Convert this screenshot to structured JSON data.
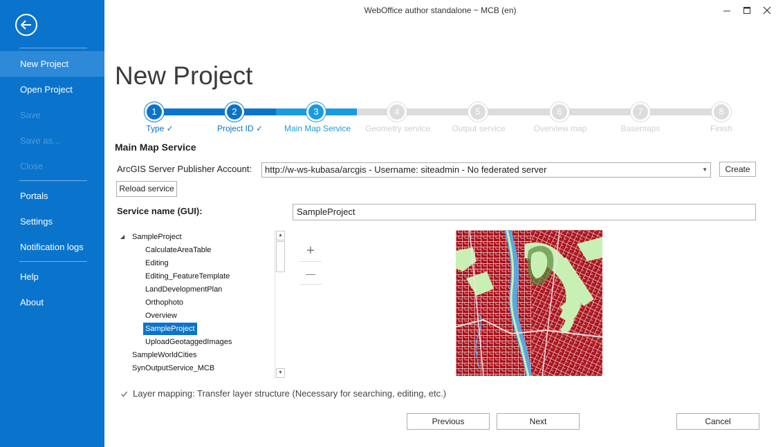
{
  "window": {
    "title": "WebOffice author standalone ~ MCB (en)"
  },
  "sidebar": {
    "items": [
      {
        "label": "New Project",
        "state": "active"
      },
      {
        "label": "Open Project",
        "state": "normal"
      },
      {
        "label": "Save",
        "state": "disabled"
      },
      {
        "label": "Save as...",
        "state": "disabled"
      },
      {
        "label": "Close",
        "state": "disabled"
      },
      {
        "label": "Portals",
        "state": "normal"
      },
      {
        "label": "Settings",
        "state": "normal"
      },
      {
        "label": "Notification logs",
        "state": "normal"
      },
      {
        "label": "Help",
        "state": "normal"
      },
      {
        "label": "About",
        "state": "normal"
      }
    ]
  },
  "page": {
    "title": "New Project"
  },
  "wizard": {
    "steps": [
      {
        "number": "1",
        "label": "Type ✓",
        "status": "done"
      },
      {
        "number": "2",
        "label": "Project ID ✓",
        "status": "done"
      },
      {
        "number": "3",
        "label": "Main Map Service",
        "status": "current"
      },
      {
        "number": "4",
        "label": "Geometry service",
        "status": "pending"
      },
      {
        "number": "5",
        "label": "Output service",
        "status": "pending"
      },
      {
        "number": "6",
        "label": "Overview map",
        "status": "pending"
      },
      {
        "number": "7",
        "label": "Basemaps",
        "status": "pending"
      },
      {
        "number": "8",
        "label": "Finish",
        "status": "pending"
      }
    ]
  },
  "main": {
    "section_title": "Main Map Service",
    "publisher_label": "ArcGIS Server Publisher Account:",
    "publisher_value": "http://w-ws-kubasa/arcgis  -  Username: siteadmin - No federated server",
    "create_label": "Create",
    "reload_label": "Reload service",
    "service_name_label": "Service name (GUI):",
    "service_name_value": "SampleProject",
    "tree": {
      "root": "SampleProject",
      "children": [
        "CalculateAreaTable",
        "Editing",
        "Editing_FeatureTemplate",
        "LandDevelopmentPlan",
        "Orthophoto",
        "Overview",
        "SampleProject",
        "UploadGeotaggedImages"
      ],
      "selected_child": "SampleProject",
      "siblings": [
        "SampleWorldCities",
        "SynOutputService_MCB"
      ]
    },
    "zoom_in": "+",
    "zoom_out": "—",
    "layer_mapping_label": "Layer mapping: Transfer layer structure (Necessary for searching, editing, etc.)",
    "layer_mapping_checked": true
  },
  "footer": {
    "previous": "Previous",
    "next": "Next",
    "cancel": "Cancel"
  },
  "colors": {
    "accent": "#0a74cc",
    "current_step": "#1a9be0",
    "pending_step": "#dcdcdc",
    "map_buildings": "#a8121c",
    "map_green": "#c9f0b4",
    "map_water": "#5aa6e0"
  }
}
